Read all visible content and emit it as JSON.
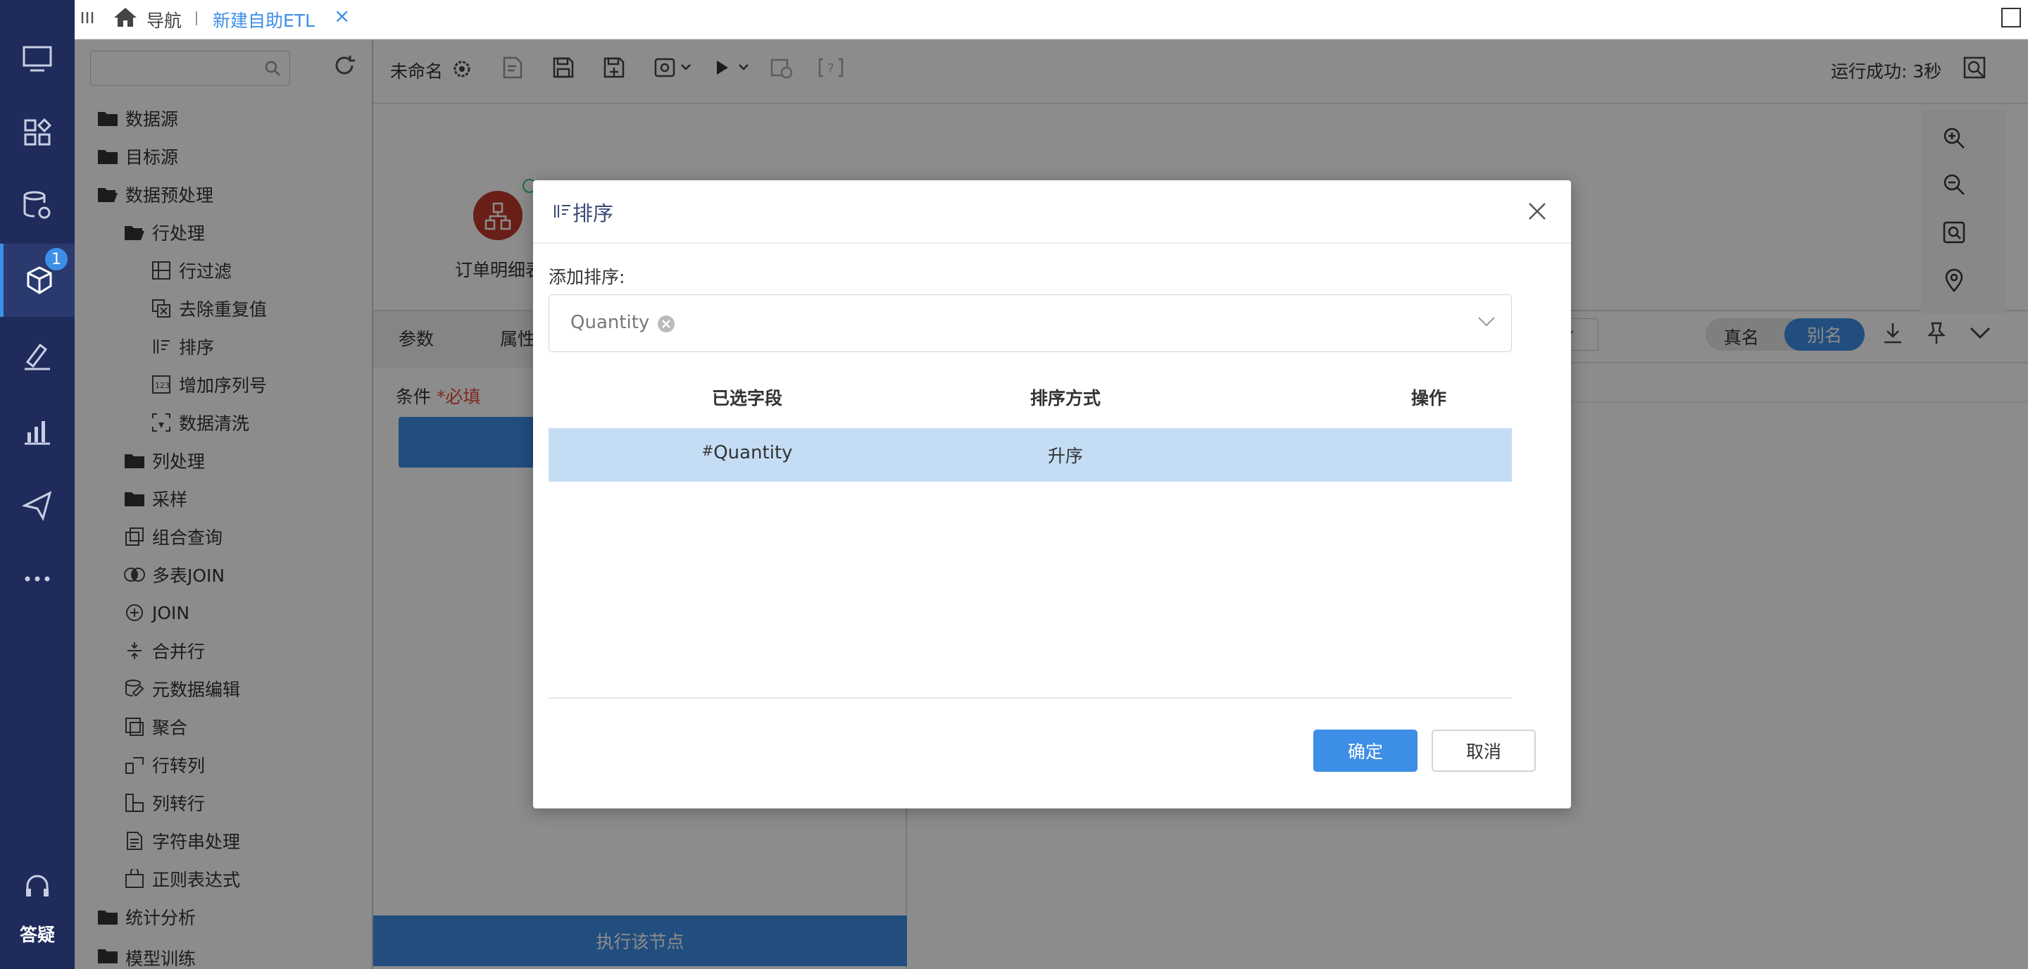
{
  "topbar": {
    "menu_icon": "menu-lines-icon",
    "home_label": "导航",
    "active_tab": "新建自助ETL",
    "close_glyph": "×"
  },
  "leftnav": {
    "badge_count": "1",
    "help_label": "答疑",
    "icons": [
      "monitor-icon",
      "dashboard-icon",
      "database-gear-icon",
      "cube-icon",
      "paint-icon",
      "chart-icon",
      "send-icon",
      "more-icon"
    ]
  },
  "tree": {
    "search_placeholder": "",
    "items": [
      {
        "label": "数据源"
      },
      {
        "label": "目标源"
      },
      {
        "label": "数据预处理"
      },
      {
        "label": "行处理"
      },
      {
        "label": "行过滤"
      },
      {
        "label": "去除重复值"
      },
      {
        "label": "排序"
      },
      {
        "label": "增加序列号"
      },
      {
        "label": "数据清洗"
      },
      {
        "label": "列处理"
      },
      {
        "label": "采样"
      },
      {
        "label": "组合查询"
      },
      {
        "label": "多表JOIN"
      },
      {
        "label": "JOIN"
      },
      {
        "label": "合并行"
      },
      {
        "label": "元数据编辑"
      },
      {
        "label": "聚合"
      },
      {
        "label": "行转列"
      },
      {
        "label": "列转行"
      },
      {
        "label": "字符串处理"
      },
      {
        "label": "正则表达式"
      },
      {
        "label": "统计分析"
      },
      {
        "label": "模型训练"
      }
    ]
  },
  "toolbar": {
    "doc_name": "未命名",
    "run_status": "运行成功: 3秒"
  },
  "canvas": {
    "node_label": "订单明细表"
  },
  "bottom_panel": {
    "tab_params": "参数",
    "tab_props": "属性",
    "condition_label": "条件",
    "required_mark": "*必填",
    "run_node_button": "执行该节点"
  },
  "right_panel": {
    "real_name": "真名",
    "alias": "别名"
  },
  "dialog": {
    "title": "排序",
    "add_sort_label": "添加排序:",
    "selected_tag": "Quantity",
    "columns": [
      "已选字段",
      "排序方式",
      "操作"
    ],
    "rows": [
      {
        "type_mark": "#",
        "field": "Quantity",
        "order": "升序",
        "action": ""
      }
    ],
    "ok_button": "确定",
    "cancel_button": "取消"
  },
  "colors": {
    "nav_bg": "#1f2b5b",
    "accent": "#3d8ee6",
    "row_selected": "#c4ddf5",
    "node_red": "#c0392b"
  }
}
